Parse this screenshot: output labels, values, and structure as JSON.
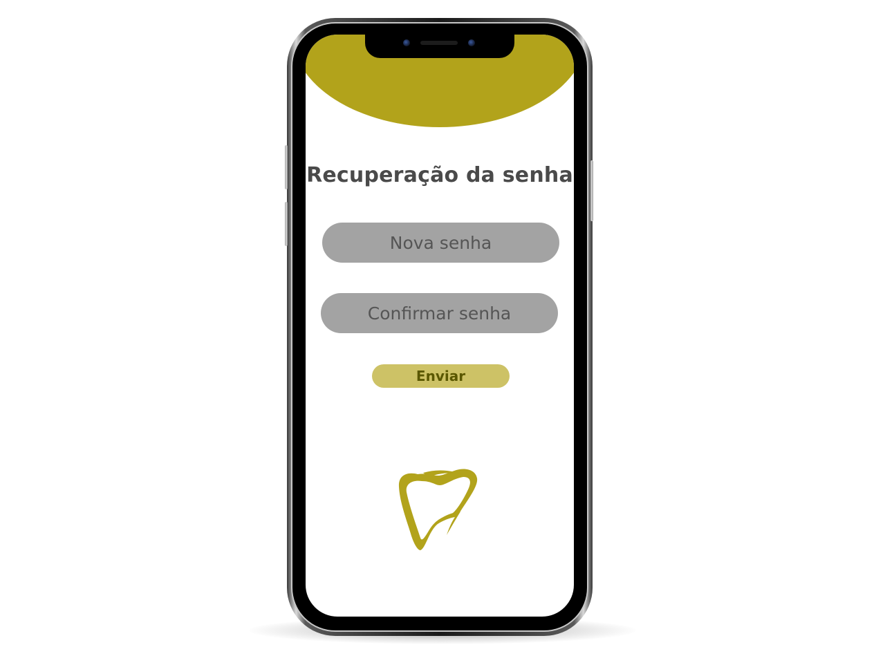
{
  "colors": {
    "accent": "#b2a31b",
    "button_bg": "#cdc266",
    "button_text": "#5a5700",
    "field_bg": "#a3a3a3",
    "field_text": "#555555",
    "title_text": "#4a4a4a"
  },
  "screen": {
    "title": "Recuperação da senha",
    "new_password_placeholder": "Nova senha",
    "confirm_password_placeholder": "Confirmar senha",
    "submit_label": "Enviar"
  },
  "icons": {
    "logo": "tooth-logo-icon"
  }
}
